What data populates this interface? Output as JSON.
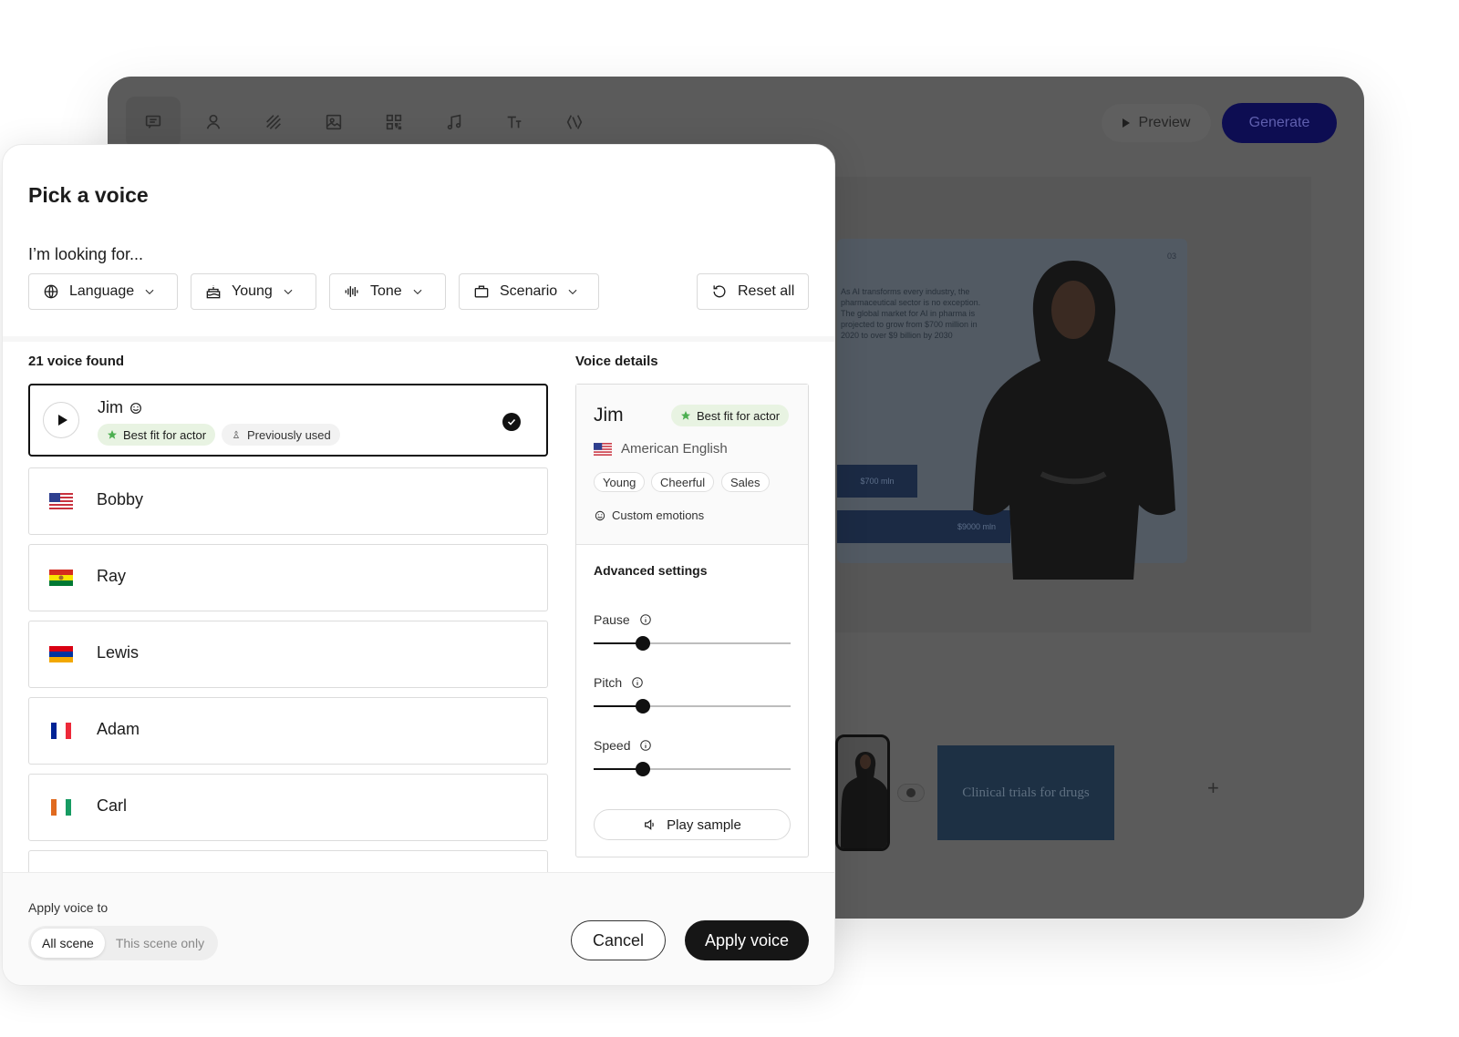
{
  "editor": {
    "toolbar_icons": [
      "chat-icon",
      "person-icon",
      "pattern-icon",
      "image-icon",
      "qr-icon",
      "music-icon",
      "text-icon",
      "shape-icon"
    ],
    "preview_label": "Preview",
    "generate_label": "Generate",
    "slide": {
      "number": "03",
      "body": "As AI transforms every industry, the pharmaceutical sector is no exception. The global market for AI in pharma is projected to grow from $700 million in 2020 to over $9 billion by 2030",
      "bar1": "$700 mln",
      "bar2": "$9000 mln"
    },
    "scene_card_title": "Clinical trials for drugs",
    "add_scene": "+"
  },
  "modal": {
    "title": "Pick a voice",
    "looking_for": "I’m looking for...",
    "filters": {
      "language": "Language",
      "age": "Young",
      "tone": "Tone",
      "scenario": "Scenario",
      "reset": "Reset all"
    },
    "voices_found": "21 voice found",
    "selected_voice": {
      "name": "Jim",
      "badge_best": "Best fit for actor",
      "badge_prev": "Previously used"
    },
    "voices": [
      {
        "name": "Bobby",
        "flag": "us-flag-icon"
      },
      {
        "name": "Ray",
        "flag": "bolivia-flag-icon"
      },
      {
        "name": "Lewis",
        "flag": "armenia-flag-icon"
      },
      {
        "name": "Adam",
        "flag": "france-flag-icon"
      },
      {
        "name": "Carl",
        "flag": "ireland-flag-icon"
      }
    ],
    "details": {
      "heading": "Voice details",
      "name": "Jim",
      "badge": "Best fit for actor",
      "language": "American English",
      "tags": [
        "Young",
        "Cheerful",
        "Sales"
      ],
      "custom_emotions": "Custom emotions",
      "advanced_title": "Advanced settings",
      "pause_label": "Pause",
      "pause_value": 0.25,
      "pitch_label": "Pitch",
      "pitch_value": 0.25,
      "speed_label": "Speed",
      "speed_value": 0.25,
      "play_sample": "Play sample"
    },
    "footer": {
      "apply_to": "Apply voice to",
      "option_all": "All scene",
      "option_this": "This scene only",
      "cancel": "Cancel",
      "apply": "Apply voice"
    }
  },
  "colors": {
    "accent_dark": "#161616",
    "badge_green": "#e8f3e2",
    "star_green": "#4caf50",
    "generate_navy": "#0d0d52"
  }
}
